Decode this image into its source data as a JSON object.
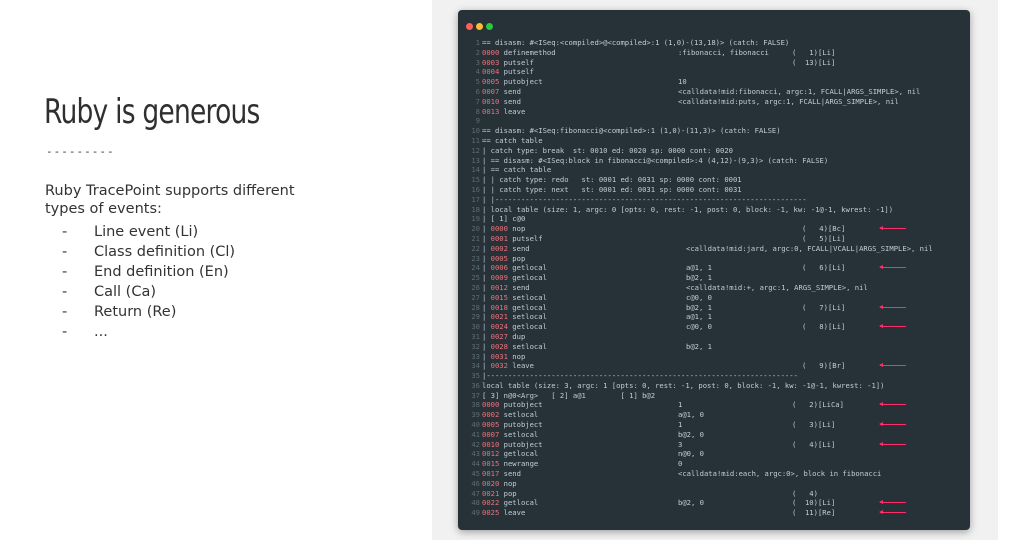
{
  "slide": {
    "title": "Ruby is generous",
    "divider": "---------",
    "intro": "Ruby TracePoint supports different types of events:",
    "bullets": [
      "Line event (Li)",
      "Class definition (Cl)",
      "End definition (En)",
      "Call (Ca)",
      "Return (Re)",
      "..."
    ],
    "bullet_marker": "-"
  },
  "terminal": {
    "arrow_color": "#ff2d6a",
    "lines": [
      {
        "n": "1",
        "text": "== disasm: #<ISeq:<compiled>@<compiled>:1 (1,0)-(13,18)> (catch: FALSE)"
      },
      {
        "n": "2",
        "pre": "",
        "off": "0000",
        "op": "definemethod",
        "oc": "a",
        "opd": ":fibonacci, fibonacci",
        "cc": "x",
        "info": "(   1)[Li]"
      },
      {
        "n": "3",
        "pre": "",
        "off": "0003",
        "op": "putself",
        "cc": "x",
        "info": "(  13)[Li]"
      },
      {
        "n": "4",
        "pre": "",
        "off": "0004",
        "op": "putself"
      },
      {
        "n": "5",
        "pre": "",
        "off": "0005",
        "op": "putobject",
        "oc": "a",
        "opd": "10"
      },
      {
        "n": "6",
        "pre": "",
        "off": "0007",
        "op": "send",
        "oc": "a",
        "opd": "<calldata!mid:fibonacci, argc:1, FCALL|ARGS_SIMPLE>, nil"
      },
      {
        "n": "7",
        "pre": "",
        "off": "0010",
        "op": "send",
        "oc": "a",
        "opd": "<calldata!mid:puts, argc:1, FCALL|ARGS_SIMPLE>, nil"
      },
      {
        "n": "8",
        "pre": "",
        "off": "0013",
        "op": "leave"
      },
      {
        "n": "9",
        "text": ""
      },
      {
        "n": "10",
        "text": "== disasm: #<ISeq:fibonacci@<compiled>:1 (1,0)-(11,3)> (catch: FALSE)"
      },
      {
        "n": "11",
        "text": "== catch table"
      },
      {
        "n": "12",
        "text": "| catch type: break  st: 0010 ed: 0020 sp: 0000 cont: 0020"
      },
      {
        "n": "13",
        "text": "| == disasm: #<ISeq:block in fibonacci@<compiled>:4 (4,12)-(9,3)> (catch: FALSE)"
      },
      {
        "n": "14",
        "text": "| == catch table"
      },
      {
        "n": "15",
        "text": "| | catch type: redo   st: 0001 ed: 0031 sp: 0000 cont: 0001"
      },
      {
        "n": "16",
        "text": "| | catch type: next   st: 0001 ed: 0031 sp: 0000 cont: 0031"
      },
      {
        "n": "17",
        "text": "| |------------------------------------------------------------------------"
      },
      {
        "n": "18",
        "text": "| local table (size: 1, argc: 0 [opts: 0, rest: -1, post: 0, block: -1, kw: -1@-1, kwrest: -1])"
      },
      {
        "n": "19",
        "text": "| [ 1] c@0"
      },
      {
        "n": "20",
        "pre": "| ",
        "off": "0000",
        "op": "nop",
        "cc": "y",
        "info": "(   4)[Bc]",
        "arrow": true
      },
      {
        "n": "21",
        "pre": "| ",
        "off": "0001",
        "op": "putself",
        "cc": "y",
        "info": "(   5)[Li]"
      },
      {
        "n": "22",
        "pre": "| ",
        "off": "0002",
        "op": "send",
        "oc": "b",
        "opd": "<calldata!mid:jard, argc:0, FCALL|VCALL|ARGS_SIMPLE>, nil"
      },
      {
        "n": "23",
        "pre": "| ",
        "off": "0005",
        "op": "pop"
      },
      {
        "n": "24",
        "pre": "| ",
        "off": "0006",
        "op": "getlocal",
        "oc": "b",
        "opd": "a@1, 1",
        "cc": "y",
        "info": "(   6)[Li]",
        "arrow": true
      },
      {
        "n": "25",
        "pre": "| ",
        "off": "0009",
        "op": "getlocal",
        "oc": "b",
        "opd": "b@2, 1"
      },
      {
        "n": "26",
        "pre": "| ",
        "off": "0012",
        "op": "send",
        "oc": "b",
        "opd": "<calldata!mid:+, argc:1, ARGS_SIMPLE>, nil"
      },
      {
        "n": "27",
        "pre": "| ",
        "off": "0015",
        "op": "setlocal",
        "oc": "b",
        "opd": "c@0, 0"
      },
      {
        "n": "28",
        "pre": "| ",
        "off": "0018",
        "op": "getlocal",
        "oc": "b",
        "opd": "b@2, 1",
        "cc": "y",
        "info": "(   7)[Li]",
        "arrow": true
      },
      {
        "n": "29",
        "pre": "| ",
        "off": "0021",
        "op": "setlocal",
        "oc": "b",
        "opd": "a@1, 1"
      },
      {
        "n": "30",
        "pre": "| ",
        "off": "0024",
        "op": "getlocal",
        "oc": "b",
        "opd": "c@0, 0",
        "cc": "y",
        "info": "(   8)[Li]",
        "arrow": true
      },
      {
        "n": "31",
        "pre": "| ",
        "off": "0027",
        "op": "dup"
      },
      {
        "n": "32",
        "pre": "| ",
        "off": "0028",
        "op": "setlocal",
        "oc": "b",
        "opd": "b@2, 1"
      },
      {
        "n": "33",
        "pre": "| ",
        "off": "0031",
        "op": "nop"
      },
      {
        "n": "34",
        "pre": "| ",
        "off": "0032",
        "op": "leave",
        "cc": "y",
        "info": "(   9)[Br]",
        "arrow": true
      },
      {
        "n": "35",
        "text": "|------------------------------------------------------------------------"
      },
      {
        "n": "36",
        "text": "local table (size: 3, argc: 1 [opts: 0, rest: -1, post: 0, block: -1, kw: -1@-1, kwrest: -1])"
      },
      {
        "n": "37",
        "text": "[ 3] n@0<Arg>   [ 2] a@1        [ 1] b@2"
      },
      {
        "n": "38",
        "pre": "",
        "off": "0000",
        "op": "putobject",
        "oc": "a",
        "opd": "1",
        "cc": "x",
        "info": "(   2)[LiCa]",
        "arrow": true
      },
      {
        "n": "39",
        "pre": "",
        "off": "0002",
        "op": "setlocal",
        "oc": "a",
        "opd": "a@1, 0"
      },
      {
        "n": "40",
        "pre": "",
        "off": "0005",
        "op": "putobject",
        "oc": "a",
        "opd": "1",
        "cc": "x",
        "info": "(   3)[Li]",
        "arrow": true
      },
      {
        "n": "41",
        "pre": "",
        "off": "0007",
        "op": "setlocal",
        "oc": "a",
        "opd": "b@2, 0"
      },
      {
        "n": "42",
        "pre": "",
        "off": "0010",
        "op": "putobject",
        "oc": "a",
        "opd": "3",
        "cc": "x",
        "info": "(   4)[Li]",
        "arrow": true
      },
      {
        "n": "43",
        "pre": "",
        "off": "0012",
        "op": "getlocal",
        "oc": "a",
        "opd": "n@0, 0"
      },
      {
        "n": "44",
        "pre": "",
        "off": "0015",
        "op": "newrange",
        "oc": "a",
        "opd": "0"
      },
      {
        "n": "45",
        "pre": "",
        "off": "0017",
        "op": "send",
        "oc": "a",
        "opd": "<calldata!mid:each, argc:0>, block in fibonacci"
      },
      {
        "n": "46",
        "pre": "",
        "off": "0020",
        "op": "nop"
      },
      {
        "n": "47",
        "pre": "",
        "off": "0021",
        "op": "pop",
        "cc": "x",
        "info": "(   4)"
      },
      {
        "n": "48",
        "pre": "",
        "off": "0022",
        "op": "getlocal",
        "oc": "a",
        "opd": "b@2, 0",
        "cc": "x",
        "info": "(  10)[Li]",
        "arrow": true
      },
      {
        "n": "49",
        "pre": "",
        "off": "0025",
        "op": "leave",
        "cc": "x",
        "info": "(  11)[Re]",
        "arrow": true
      }
    ]
  }
}
